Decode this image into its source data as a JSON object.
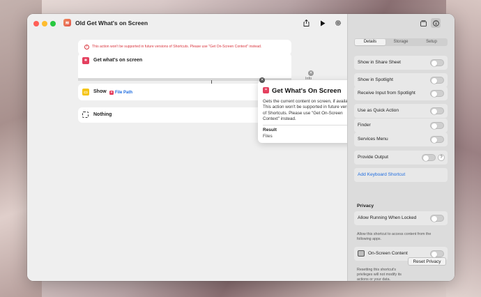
{
  "window": {
    "title": "Old Get What's on Screen",
    "app_icon": "shortcuts-icon"
  },
  "toolbar": {
    "share_icon": "share-icon",
    "run_icon": "play-icon",
    "settings_icon": "gear-icon"
  },
  "warning": {
    "text": "This action won't be supported in future versions of Shortcuts. Please use \"Get On-Screen Context\" instead."
  },
  "actions": [
    {
      "label": "Get what's on screen",
      "color": "#e4405f",
      "icon": "screen-capture-icon"
    },
    {
      "label": "Show",
      "color": "#f5c518",
      "icon": "show-icon",
      "variable": "File Path"
    },
    {
      "label": "Nothing",
      "icon": "nothing-icon"
    }
  ],
  "popover": {
    "tab": "Info",
    "title": "Get What's On Screen",
    "description": "Gets the current content on screen, if available. This action won't be supported in future versions of Shortcuts. Please use \"Get On-Screen Context\" instead.",
    "result_label": "Result",
    "result_value": "Files"
  },
  "sidebar": {
    "tabs": [
      "Details",
      "Storage",
      "Setup"
    ],
    "active_tab": "Details",
    "rows": [
      "Show in Share Sheet",
      "Show in Spotlight",
      "Receive Input from Spotlight",
      "Use as Quick Action",
      "Finder",
      "Services Menu",
      "Provide Output"
    ],
    "help_label": "?",
    "keyboard_shortcut": "Add Keyboard Shortcut",
    "privacy": {
      "title": "Privacy",
      "allow_locked": "Allow Running When Locked",
      "access_note": "Allow this shortcut to access content from the following apps.",
      "onscreen": "On-Screen Content",
      "reset_note": "Resetting this shortcut's privileges will not modify its actions or your data.",
      "reset_button": "Reset Privacy"
    }
  },
  "colors": {
    "accent": "#1f6de0",
    "warning": "#d9363e"
  }
}
